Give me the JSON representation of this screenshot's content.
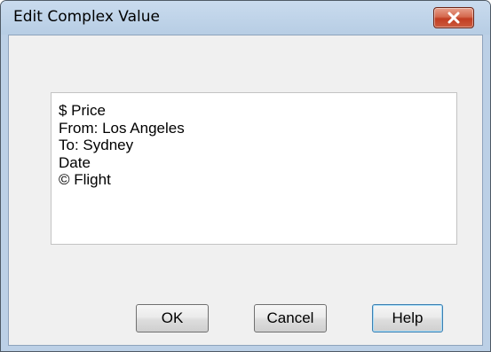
{
  "window": {
    "title": "Edit Complex Value",
    "close_icon": "close-x-icon"
  },
  "value_box": {
    "lines": [
      "$ Price",
      "From: Los Angeles",
      "To: Sydney",
      "Date",
      "© Flight"
    ]
  },
  "buttons": {
    "ok_label": "OK",
    "cancel_label": "Cancel",
    "help_label": "Help"
  },
  "colors": {
    "frame": "#bcd0e6",
    "client_background": "#f0f0f0",
    "close_button": "#c13d22",
    "default_button_border": "#3c7fb1"
  }
}
